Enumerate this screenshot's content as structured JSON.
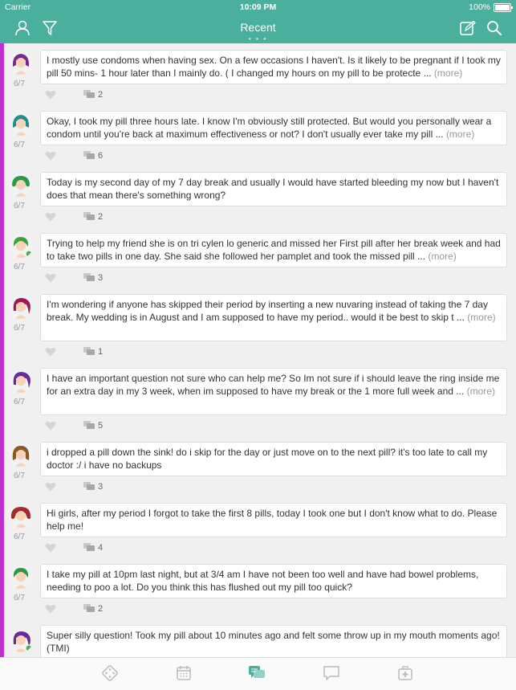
{
  "status_bar": {
    "carrier": "Carrier",
    "time": "10:09 PM",
    "battery": "100%"
  },
  "header": {
    "title": "Recent",
    "left_icons": [
      "user-icon",
      "filter-icon"
    ],
    "right_icons": [
      "compose-icon",
      "search-icon"
    ]
  },
  "colors": {
    "header": "#4aaf9c",
    "stripe": "#c12fd0"
  },
  "posts": [
    {
      "date": "6/7",
      "text": "I mostly use condoms when having sex. On a few occasions I haven't. Is it likely to be pregnant if I took my pill 50 mins- 1 hour later than I mainly do. ( I changed my hours on my pill to be protecte ...",
      "more": "(more)",
      "comments": "2"
    },
    {
      "date": "6/7",
      "text": "Okay, I took my pill three hours late. I know I'm obviously still protected. But would you personally wear a condom until you're back at maximum effectiveness or not? I don't usually ever take my pill ...",
      "more": "(more)",
      "comments": "6"
    },
    {
      "date": "6/7",
      "text": "Today is my second day of my 7 day break and usually I would have started bleeding my now but I haven't does that mean there's something wrong?",
      "more": "",
      "comments": "2"
    },
    {
      "date": "6/7",
      "text": "Trying to help my friend she is on tri cylen lo generic and missed her First pill after her break week and had to take two pills in one day. She said she followed her pamplet and took the missed pill ...",
      "more": "(more)",
      "comments": "3"
    },
    {
      "date": "6/7",
      "text": "I'm wondering if anyone has skipped their period by inserting a new nuvaring instead of taking the 7 day break. My wedding is in August and I am supposed to have my period.. would it be best to skip t ...",
      "more": "(more)",
      "comments": "1"
    },
    {
      "date": "6/7",
      "text": "I have an important question not sure who can help me? So Im not sure if i should leave the ring inside me for an extra day in my 3 week, when im supposed to have my break or the 1 more full week and ...",
      "more": "(more)",
      "comments": "5"
    },
    {
      "date": "6/7",
      "text": "i dropped a pill down the sink! do i skip for the day or just move on to the next pill? it's too late to call my doctor :/ i have no backups",
      "more": "",
      "comments": "3"
    },
    {
      "date": "6/7",
      "text": "Hi girls, after my period I forgot to take the first 8 pills, today I took one but I don't know what to do. Please help me!",
      "more": "",
      "comments": "4"
    },
    {
      "date": "6/7",
      "text": "I take my pill at 10pm last night, but at 3/4 am I have not been too well and have had bowel problems, needing to poo a lot. Do you think this has flushed out my pill too quick?",
      "more": "",
      "comments": "2"
    },
    {
      "date": "",
      "text": "Super silly question! Took my pill about 10 minutes ago and felt some throw up in my mouth moments ago! (TMI)",
      "more": "",
      "comments": ""
    }
  ],
  "tabbar": {
    "tabs": [
      "dice-icon",
      "calendar-icon",
      "chat-icon",
      "message-icon",
      "medical-kit-icon"
    ],
    "active": "chat-icon"
  }
}
